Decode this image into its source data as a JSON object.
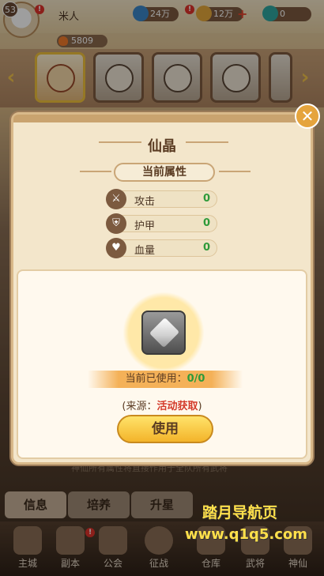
{
  "player": {
    "level": "53",
    "name": "米人",
    "power": "5809"
  },
  "resources": [
    {
      "icon": "blue-gem-icon",
      "value": "24万",
      "color": "#3a86c8"
    },
    {
      "icon": "gold-ingot-icon",
      "value": "12万",
      "color": "#e5a93a"
    },
    {
      "icon": "green-diamond-icon",
      "value": "0",
      "color": "#2fa7a0"
    }
  ],
  "popup": {
    "title": "仙晶",
    "section_label": "当前属性",
    "attributes": [
      {
        "icon": "sword-icon",
        "label": "攻击",
        "value": "0"
      },
      {
        "icon": "shield-icon",
        "label": "护甲",
        "value": "0"
      },
      {
        "icon": "heart-icon",
        "label": "血量",
        "value": "0"
      }
    ],
    "used_label": "当前已使用：",
    "used_value": "0/0",
    "source_prefix": "(来源：",
    "source_link": "活动获取",
    "source_suffix": ")",
    "use_button": "使用"
  },
  "tabs": [
    "信息",
    "培养",
    "升星"
  ],
  "hint": "神仙所有属性将直接作用于全队所有武将",
  "nav": [
    "主城",
    "副本",
    "公会",
    "征战",
    "仓库",
    "武将",
    "神仙"
  ],
  "watermark": {
    "line1": "踏月导航页",
    "line2": "www.q1q5.com"
  }
}
